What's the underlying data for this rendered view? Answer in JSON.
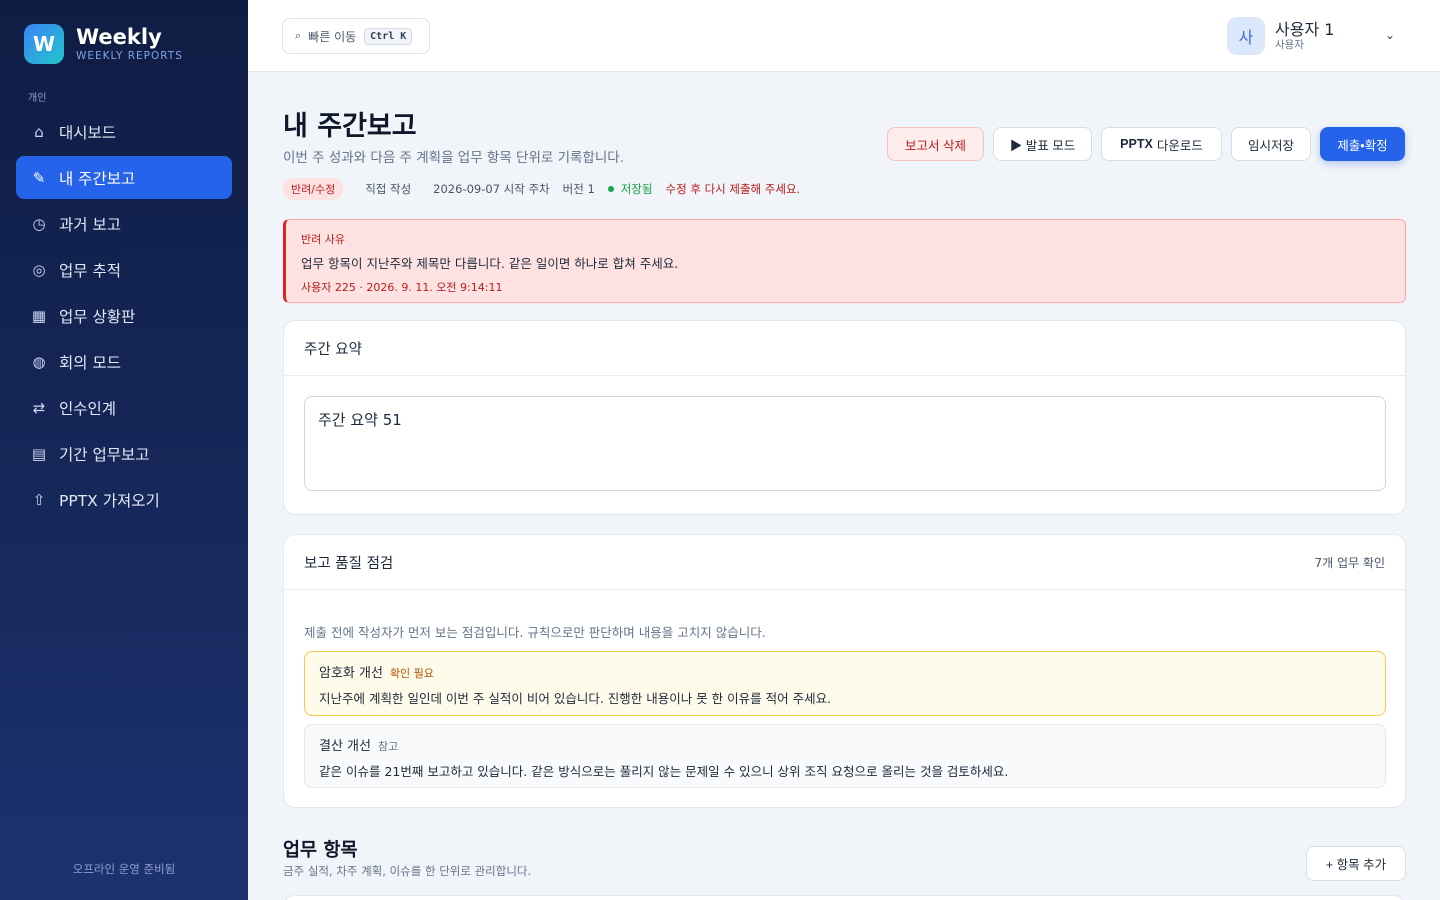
{
  "sidebar": {
    "logo_letter": "W",
    "brand_title": "Weekly",
    "brand_subtitle": "WEEKLY REPORTS",
    "section_label": "개인",
    "items": [
      {
        "icon": "home-icon",
        "glyph": "⌂",
        "label": "대시보드",
        "active": false
      },
      {
        "icon": "pencil-icon",
        "glyph": "✎",
        "label": "내 주간보고",
        "active": true
      },
      {
        "icon": "clock-icon",
        "glyph": "◷",
        "label": "과거 보고",
        "active": false
      },
      {
        "icon": "target-icon",
        "glyph": "◎",
        "label": "업무 추적",
        "active": false
      },
      {
        "icon": "grid-icon",
        "glyph": "▦",
        "label": "업무 상황판",
        "active": false
      },
      {
        "icon": "globe-icon",
        "glyph": "◍",
        "label": "회의 모드",
        "active": false
      },
      {
        "icon": "swap-icon",
        "glyph": "⇄",
        "label": "인수인계",
        "active": false
      },
      {
        "icon": "list-icon",
        "glyph": "▤",
        "label": "기간 업무보고",
        "active": false
      },
      {
        "icon": "upload-icon",
        "glyph": "⇧",
        "label": "PPTX 가져오기",
        "active": false
      }
    ],
    "footer": "오프라인 운영 준비됨"
  },
  "topbar": {
    "quick_label": "빠른 이동",
    "quick_shortcut": "Ctrl K",
    "user_avatar": "사",
    "user_name": "사용자 1",
    "user_role": "사용자"
  },
  "header": {
    "title": "내 주간보고",
    "description": "이번 주 성과와 다음 주 계획을 업무 항목 단위로 기록합니다.",
    "status_badge": "반려/수정",
    "authoring": "직접 작성",
    "week": "2026-09-07 시작 주차",
    "version": "버전 1",
    "saved": "저장됨",
    "notice": "수정 후 다시 제출해 주세요."
  },
  "actions": {
    "delete": "보고서 삭제",
    "present": "▶ 발표 모드",
    "pptx_bold": "PPTX",
    "pptx_rest": "다운로드",
    "temp_save": "임시저장",
    "submit": "제출•확정"
  },
  "reject": {
    "label": "반려 사유",
    "body": "업무 항목이 지난주와 제목만 다릅니다. 같은 일이면 하나로 합쳐 주세요.",
    "meta": "사용자 225 · 2026. 9. 11. 오전 9:14:11"
  },
  "summary": {
    "title": "주간 요약",
    "value": "주간 요약 51"
  },
  "quality": {
    "title": "보고 품질 점검",
    "count": "7개 업무 확인",
    "intro": "제출 전에 작성자가 먼저 보는 점검입니다. 규칙으로만 판단하며 내용을 고치지 않습니다.",
    "issues": [
      {
        "title": "암호화 개선",
        "tag": "확인 필요",
        "body": "지난주에 계획한 일인데 이번 주 실적이 비어 있습니다. 진행한 내용이나 못 한 이유를 적어 주세요."
      },
      {
        "title": "결산 개선",
        "tag": "참고",
        "body": "같은 이슈를 21번째 보고하고 있습니다. 같은 방식으로는 풀리지 않는 문제일 수 있으니 상위 조직 요청으로 올리는 것을 검토하세요."
      }
    ]
  },
  "work_items": {
    "title": "업무 항목",
    "description": "금주 실적, 차주 계획, 이슈를 한 단위로 관리합니다.",
    "add_button": "+ 항목 추가"
  },
  "colors": {
    "accent": "#2563eb",
    "sidebar_bg": "#0f1d44",
    "danger": "#b91c1c",
    "success": "#16a34a",
    "warning": "#b45309"
  }
}
